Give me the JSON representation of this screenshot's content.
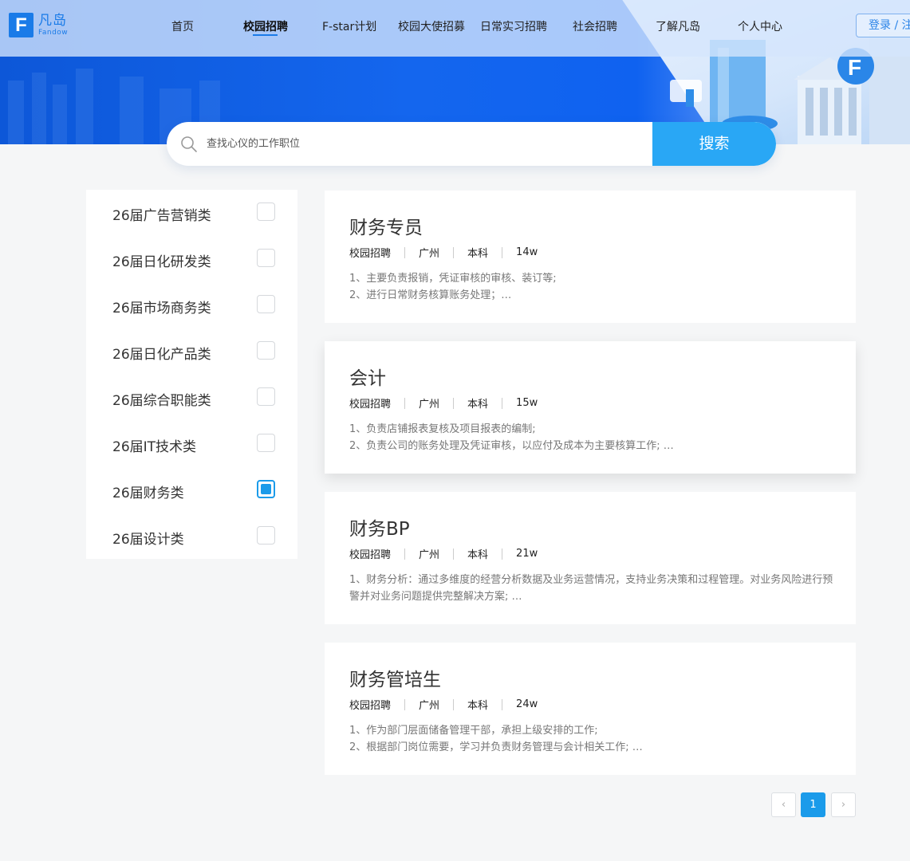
{
  "brand": {
    "mark": "F",
    "name_cn": "凡岛",
    "name_en": "Fandow"
  },
  "nav": {
    "items": [
      {
        "label": "首页"
      },
      {
        "label": "校园招聘"
      },
      {
        "label": "F-star计划"
      },
      {
        "label": "校园大使招募"
      },
      {
        "label": "日常实习招聘"
      },
      {
        "label": "社会招聘"
      },
      {
        "label": "了解凡岛"
      },
      {
        "label": "个人中心"
      }
    ],
    "active_index": 1,
    "login_label": "登录 / 注册"
  },
  "search": {
    "placeholder": "查找心仪的工作职位",
    "button_label": "搜索"
  },
  "categories": [
    {
      "label": "26届广告营销类",
      "checked": false
    },
    {
      "label": "26届日化研发类",
      "checked": false
    },
    {
      "label": "26届市场商务类",
      "checked": false
    },
    {
      "label": "26届日化产品类",
      "checked": false
    },
    {
      "label": "26届综合职能类",
      "checked": false
    },
    {
      "label": "26届IT技术类",
      "checked": false
    },
    {
      "label": "26届财务类",
      "checked": true
    },
    {
      "label": "26届设计类",
      "checked": false
    }
  ],
  "jobs": [
    {
      "title": "财务专员",
      "type": "校园招聘",
      "city": "广州",
      "degree": "本科",
      "salary": "14w",
      "desc": [
        "1、主要负责报销，凭证审核的审核、装订等;",
        "2、进行日常财务核算账务处理；…"
      ]
    },
    {
      "title": "会计",
      "type": "校园招聘",
      "city": "广州",
      "degree": "本科",
      "salary": "15w",
      "desc": [
        "1、负责店铺报表复核及项目报表的编制;",
        "2、负责公司的账务处理及凭证审核，以应付及成本为主要核算工作; …"
      ]
    },
    {
      "title": "财务BP",
      "type": "校园招聘",
      "city": "广州",
      "degree": "本科",
      "salary": "21w",
      "desc": [
        "1、财务分析：通过多维度的经营分析数据及业务运营情况，支持业务决策和过程管理。对业务风险进行预警并对业务问题提供完整解决方案; …"
      ]
    },
    {
      "title": "财务管培生",
      "type": "校园招聘",
      "city": "广州",
      "degree": "本科",
      "salary": "24w",
      "desc": [
        "1、作为部门层面储备管理干部，承担上级安排的工作;",
        "2、根据部门岗位需要，学习并负责财务管理与会计相关工作; …"
      ]
    }
  ],
  "pagination": {
    "prev": "‹",
    "current": "1",
    "next": "›"
  },
  "colors": {
    "accent": "#1b9bea",
    "search_button": "#29a7f5",
    "hero_blue": "#1466ee"
  }
}
